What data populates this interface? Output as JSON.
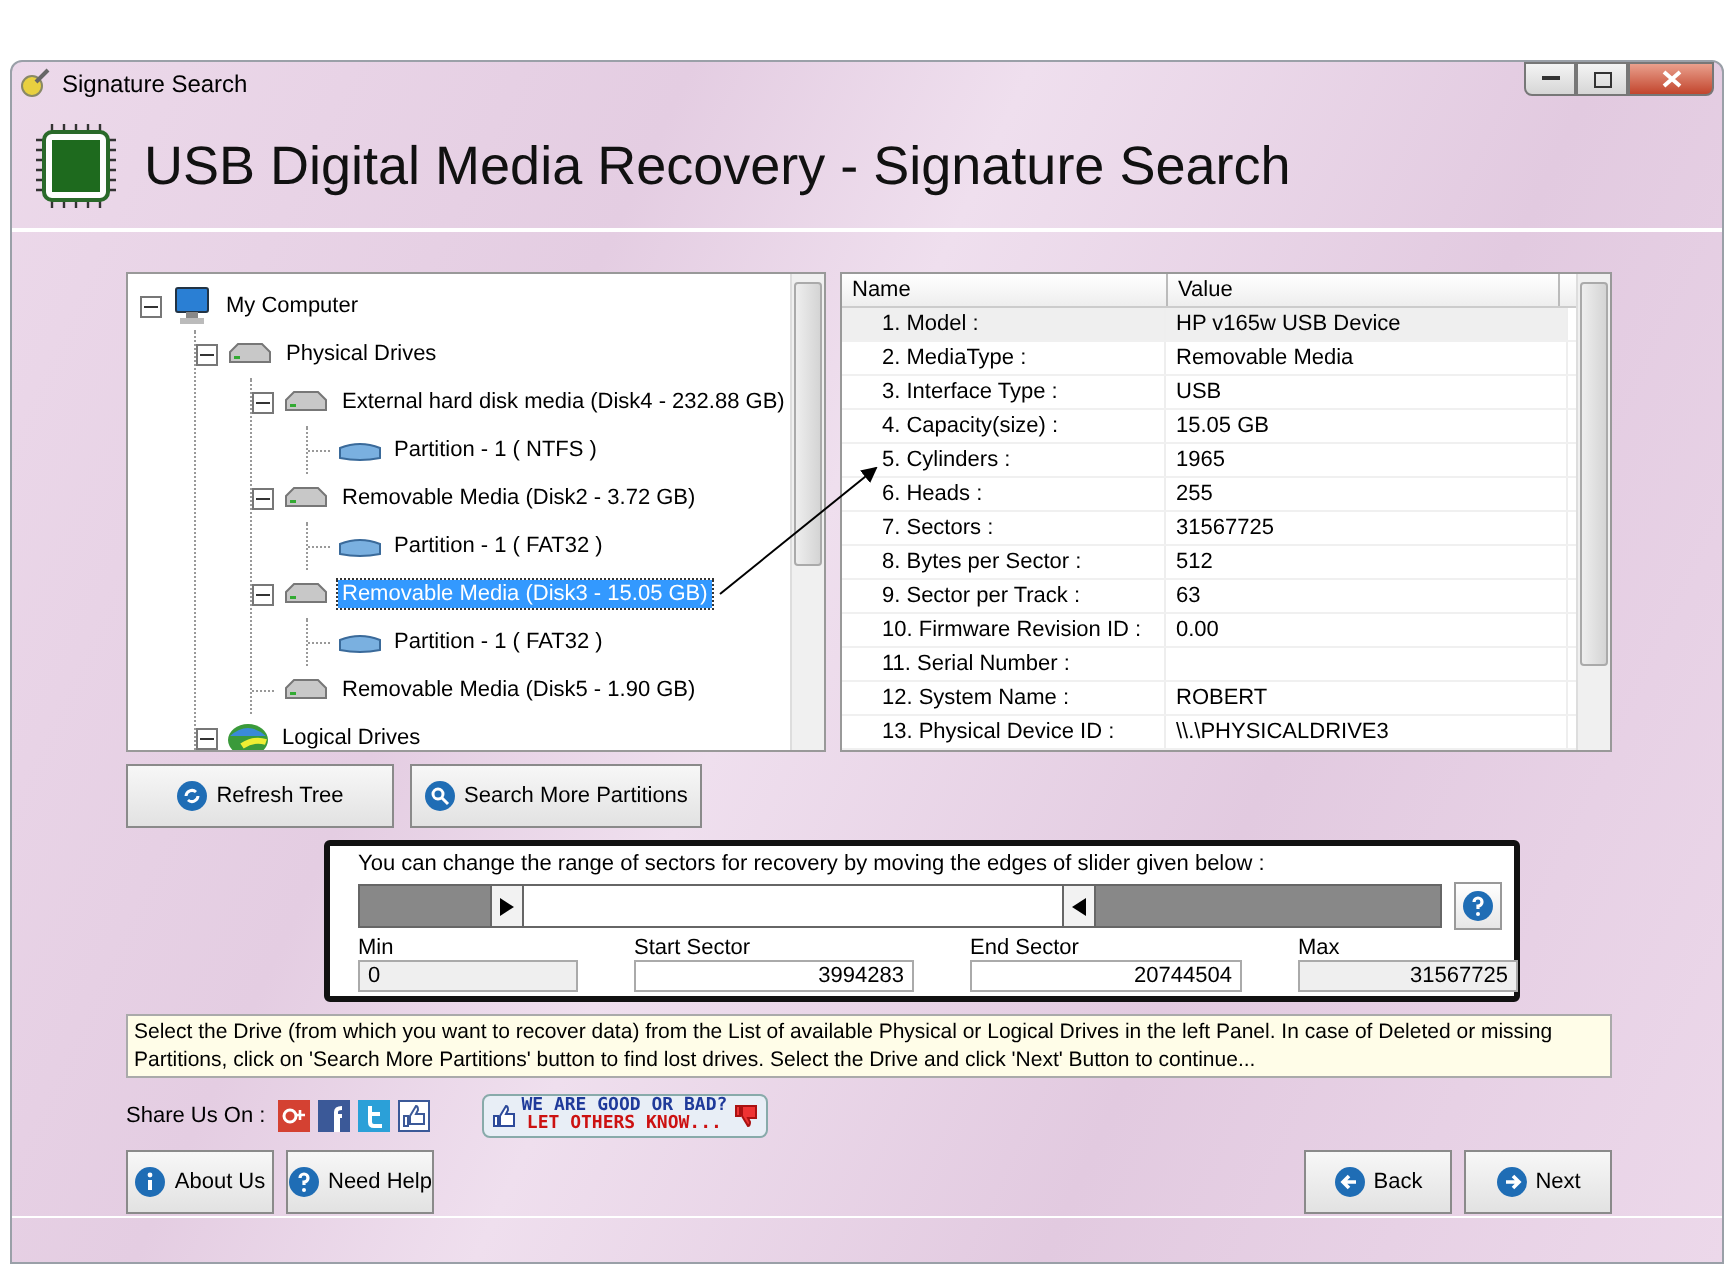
{
  "window": {
    "title": "Signature Search"
  },
  "header": {
    "title": "USB Digital Media Recovery - Signature Search"
  },
  "tree": [
    {
      "label": "My Computer",
      "kind": "computer",
      "expanded": true,
      "selected": false,
      "children": [
        {
          "label": "Physical Drives",
          "kind": "drive",
          "expanded": true,
          "selected": false,
          "children": [
            {
              "label": "External hard disk media (Disk4 - 232.88 GB)",
              "kind": "drive",
              "expanded": true,
              "selected": false,
              "children": [
                {
                  "label": "Partition - 1 ( NTFS )",
                  "kind": "partition",
                  "selected": false
                }
              ]
            },
            {
              "label": "Removable Media (Disk2 - 3.72 GB)",
              "kind": "drive",
              "expanded": true,
              "selected": false,
              "children": [
                {
                  "label": "Partition - 1 ( FAT32 )",
                  "kind": "partition",
                  "selected": false
                }
              ]
            },
            {
              "label": "Removable Media (Disk3 - 15.05 GB)",
              "kind": "drive",
              "expanded": true,
              "selected": true,
              "children": [
                {
                  "label": "Partition - 1 ( FAT32 )",
                  "kind": "partition",
                  "selected": false
                }
              ]
            },
            {
              "label": "Removable Media (Disk5 - 1.90 GB)",
              "kind": "drive",
              "selected": false
            }
          ]
        },
        {
          "label": "Logical Drives",
          "kind": "logical",
          "expanded": true,
          "selected": false
        }
      ]
    }
  ],
  "table": {
    "columns": [
      "Name",
      "Value"
    ],
    "rows": [
      {
        "name": "1. Model :",
        "value": "HP v165w USB Device",
        "selected": true
      },
      {
        "name": "2. MediaType :",
        "value": "Removable Media",
        "selected": false
      },
      {
        "name": "3. Interface Type :",
        "value": "USB",
        "selected": false
      },
      {
        "name": "4. Capacity(size) :",
        "value": "15.05 GB",
        "selected": false
      },
      {
        "name": "5. Cylinders :",
        "value": "1965",
        "selected": false
      },
      {
        "name": "6. Heads :",
        "value": "255",
        "selected": false
      },
      {
        "name": "7. Sectors :",
        "value": "31567725",
        "selected": false
      },
      {
        "name": "8. Bytes per Sector :",
        "value": "512",
        "selected": false
      },
      {
        "name": "9. Sector per Track :",
        "value": "63",
        "selected": false
      },
      {
        "name": "10. Firmware Revision ID :",
        "value": "0.00",
        "selected": false
      },
      {
        "name": "11. Serial Number :",
        "value": "",
        "selected": false
      },
      {
        "name": "12. System Name :",
        "value": "ROBERT",
        "selected": false
      },
      {
        "name": "13. Physical Device ID :",
        "value": "\\\\.\\PHYSICALDRIVE3",
        "selected": false
      }
    ]
  },
  "actions": [
    {
      "label": "Refresh Tree",
      "kind": "refresh"
    },
    {
      "label": "Search More Partitions",
      "kind": "search"
    }
  ],
  "range": {
    "hint": "You can change the range of sectors for recovery by moving the edges of slider given below :",
    "handles": [
      {
        "kind": "start",
        "level": 0.149
      },
      {
        "kind": "end",
        "level": 0.65
      }
    ],
    "fields": [
      {
        "kind": "min",
        "label": "Min",
        "value": "0",
        "readonly": true
      },
      {
        "kind": "start",
        "label": "Start Sector",
        "value": "3994283",
        "readonly": false
      },
      {
        "kind": "end",
        "label": "End Sector",
        "value": "20744504",
        "readonly": false
      },
      {
        "kind": "max",
        "label": "Max",
        "value": "31567725",
        "readonly": true
      }
    ]
  },
  "info": "Select the Drive (from which you want to recover data) from the List of available Physical or Logical Drives in the left Panel. In case of Deleted or missing Partitions, click on 'Search More Partitions' button to find lost drives. Select the Drive and click 'Next' Button to continue...",
  "share": {
    "label": "Share Us On :",
    "networks": [
      {
        "kind": "google-plus"
      },
      {
        "kind": "facebook"
      },
      {
        "kind": "twitter"
      },
      {
        "kind": "like"
      }
    ]
  },
  "feedback": {
    "line1": "WE ARE GOOD OR BAD?",
    "line2": "LET OTHERS KNOW..."
  },
  "footer_left": [
    {
      "label": "About Us",
      "kind": "info"
    },
    {
      "label": "Need Help",
      "kind": "help"
    }
  ],
  "footer_right": [
    {
      "label": "Back",
      "kind": "back"
    },
    {
      "label": "Next",
      "kind": "next"
    }
  ]
}
